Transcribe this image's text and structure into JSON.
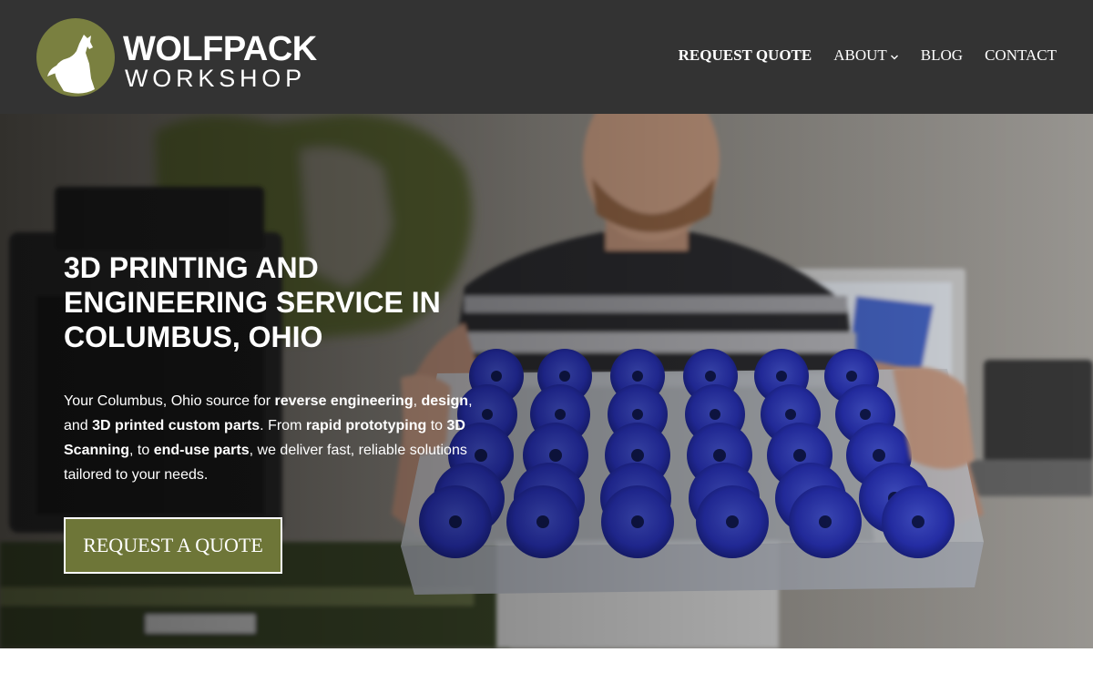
{
  "brand": {
    "name_line1": "WOLFPACK",
    "name_line2": "WORKSHOP",
    "logo_icon": "wolf-howling-icon",
    "accent_color": "#6e7638",
    "header_bg": "#333333"
  },
  "nav": {
    "items": [
      {
        "label": "REQUEST QUOTE",
        "bold": true
      },
      {
        "label": "ABOUT",
        "has_dropdown": true
      },
      {
        "label": "BLOG"
      },
      {
        "label": "CONTACT"
      }
    ]
  },
  "hero": {
    "title": "3D PRINTING AND ENGINEERING SERVICE IN COLUMBUS, OHIO",
    "description": [
      {
        "text": "Your Columbus, Ohio source for ",
        "bold": false
      },
      {
        "text": "reverse engineering",
        "bold": true
      },
      {
        "text": ", ",
        "bold": false
      },
      {
        "text": "design",
        "bold": true
      },
      {
        "text": ", and ",
        "bold": false
      },
      {
        "text": "3D printed custom parts",
        "bold": true
      },
      {
        "text": ". From ",
        "bold": false
      },
      {
        "text": "rapid prototyping",
        "bold": true
      },
      {
        "text": " to ",
        "bold": false
      },
      {
        "text": "3D Scanning",
        "bold": true
      },
      {
        "text": ", to ",
        "bold": false
      },
      {
        "text": "end-use parts",
        "bold": true
      },
      {
        "text": ", we deliver fast, reliable solutions tailored to your needs.",
        "bold": false
      }
    ],
    "cta_label": "REQUEST A QUOTE",
    "image": "man-holding-tray-of-blue-3d-printed-gears"
  }
}
